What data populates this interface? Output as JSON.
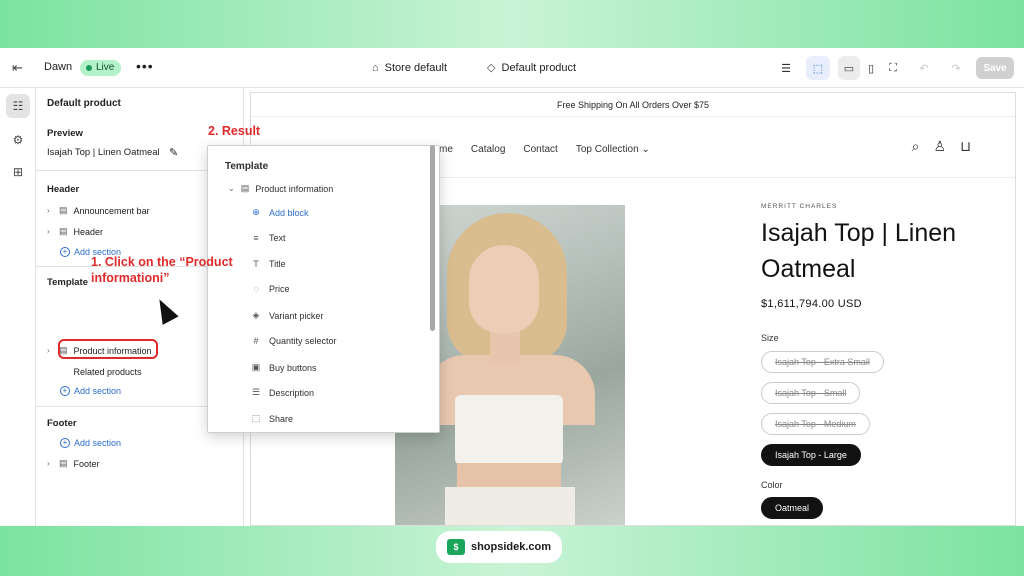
{
  "topbar": {
    "theme_name": "Dawn",
    "live_badge": "Live",
    "more": "•••",
    "store_default": "Store default",
    "default_product": "Default product",
    "save_label": "Save"
  },
  "sidebar": {
    "title": "Default product",
    "preview_heading": "Preview",
    "preview_value": "Isajah Top | Linen Oatmeal",
    "header_heading": "Header",
    "header_items": [
      "Announcement bar",
      "Header"
    ],
    "add_section": "Add section",
    "template_heading": "Template",
    "template_items": [
      "Product information",
      "Related products"
    ],
    "footer_heading": "Footer",
    "footer_items": [
      "Footer"
    ]
  },
  "annotations": {
    "step1": "1. Click on the “Product informationi”",
    "step2": "2. Result"
  },
  "preview": {
    "announcement": "Free Shipping On All Orders Over $75",
    "nav": [
      "me",
      "Catalog",
      "Contact",
      "Top Collection"
    ],
    "vendor": "MERRITT CHARLES",
    "product_title": "Isajah Top | Linen Oatmeal",
    "price": "$1,611,794.00 USD",
    "size_label": "Size",
    "sizes": [
      "Isajah Top - Extra Small",
      "Isajah Top - Small",
      "Isajah Top - Medium",
      "Isajah Top - Large"
    ],
    "color_label": "Color",
    "color_value": "Oatmeal"
  },
  "panel": {
    "title": "Template",
    "parent": "Product information",
    "add_block": "Add block",
    "blocks": [
      "Text",
      "Title",
      "Price",
      "Variant picker",
      "Quantity selector",
      "Buy buttons",
      "Description",
      "Share"
    ]
  },
  "footer_badge": {
    "label": "shopsidek.com"
  },
  "colors": {
    "accent": "#2c6ecb",
    "annotation_red": "#e02a2a",
    "live_green": "#b4f0c8",
    "background_green": "#7be3a0"
  }
}
